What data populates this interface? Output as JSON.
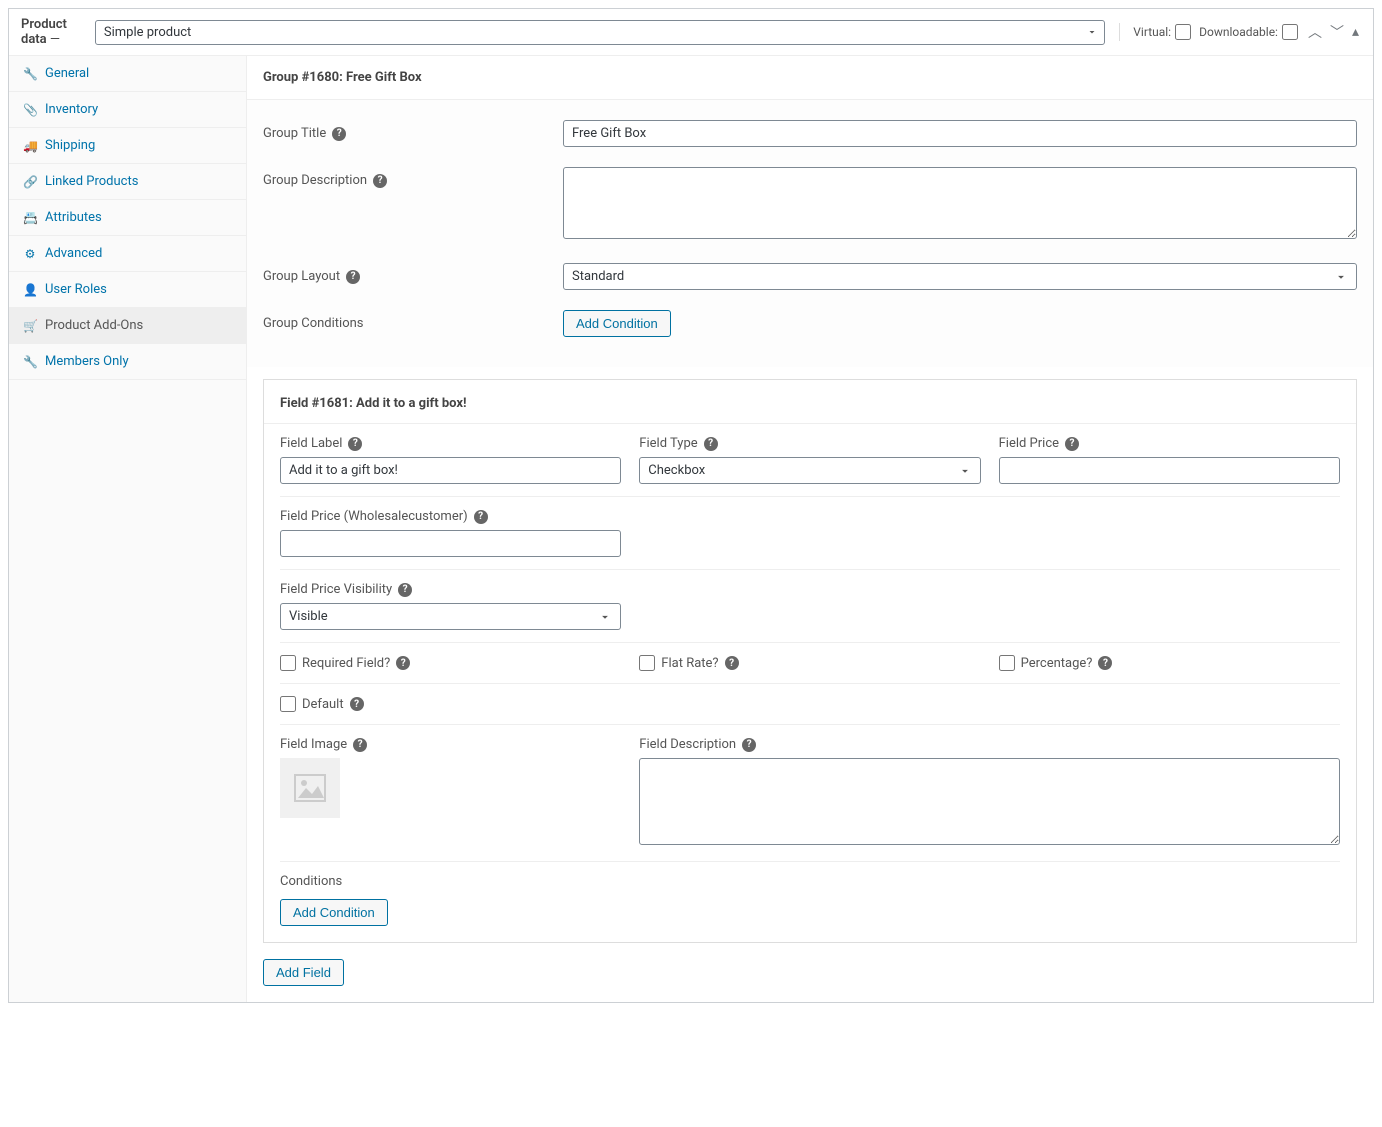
{
  "header": {
    "title": "Product data",
    "dash": "—",
    "product_type": "Simple product",
    "virtual_label": "Virtual:",
    "downloadable_label": "Downloadable:"
  },
  "sidebar": {
    "items": [
      {
        "label": "General",
        "icon": "🔧"
      },
      {
        "label": "Inventory",
        "icon": "📎"
      },
      {
        "label": "Shipping",
        "icon": "🚚"
      },
      {
        "label": "Linked Products",
        "icon": "🔗"
      },
      {
        "label": "Attributes",
        "icon": "📇"
      },
      {
        "label": "Advanced",
        "icon": "⚙"
      },
      {
        "label": "User Roles",
        "icon": "👤"
      },
      {
        "label": "Product Add-Ons",
        "icon": "🛒"
      },
      {
        "label": "Members Only",
        "icon": "🔧"
      }
    ]
  },
  "group": {
    "header": "Group #1680: Free Gift Box",
    "title_label": "Group Title",
    "title_value": "Free Gift Box",
    "description_label": "Group Description",
    "description_value": "",
    "layout_label": "Group Layout",
    "layout_value": "Standard",
    "conditions_label": "Group Conditions",
    "add_condition": "Add Condition"
  },
  "field": {
    "header": "Field #1681: Add it to a gift box!",
    "label_label": "Field Label",
    "label_value": "Add it to a gift box!",
    "type_label": "Field Type",
    "type_value": "Checkbox",
    "price_label": "Field Price",
    "price_value": "",
    "price_wholesale_label": "Field Price (Wholesalecustomer)",
    "price_wholesale_value": "",
    "visibility_label": "Field Price Visibility",
    "visibility_value": "Visible",
    "required_label": "Required Field?",
    "flatrate_label": "Flat Rate?",
    "percentage_label": "Percentage?",
    "default_label": "Default",
    "image_label": "Field Image",
    "description_label": "Field Description",
    "description_value": "",
    "conditions_label": "Conditions",
    "add_condition": "Add Condition"
  },
  "footer": {
    "add_field": "Add Field"
  }
}
